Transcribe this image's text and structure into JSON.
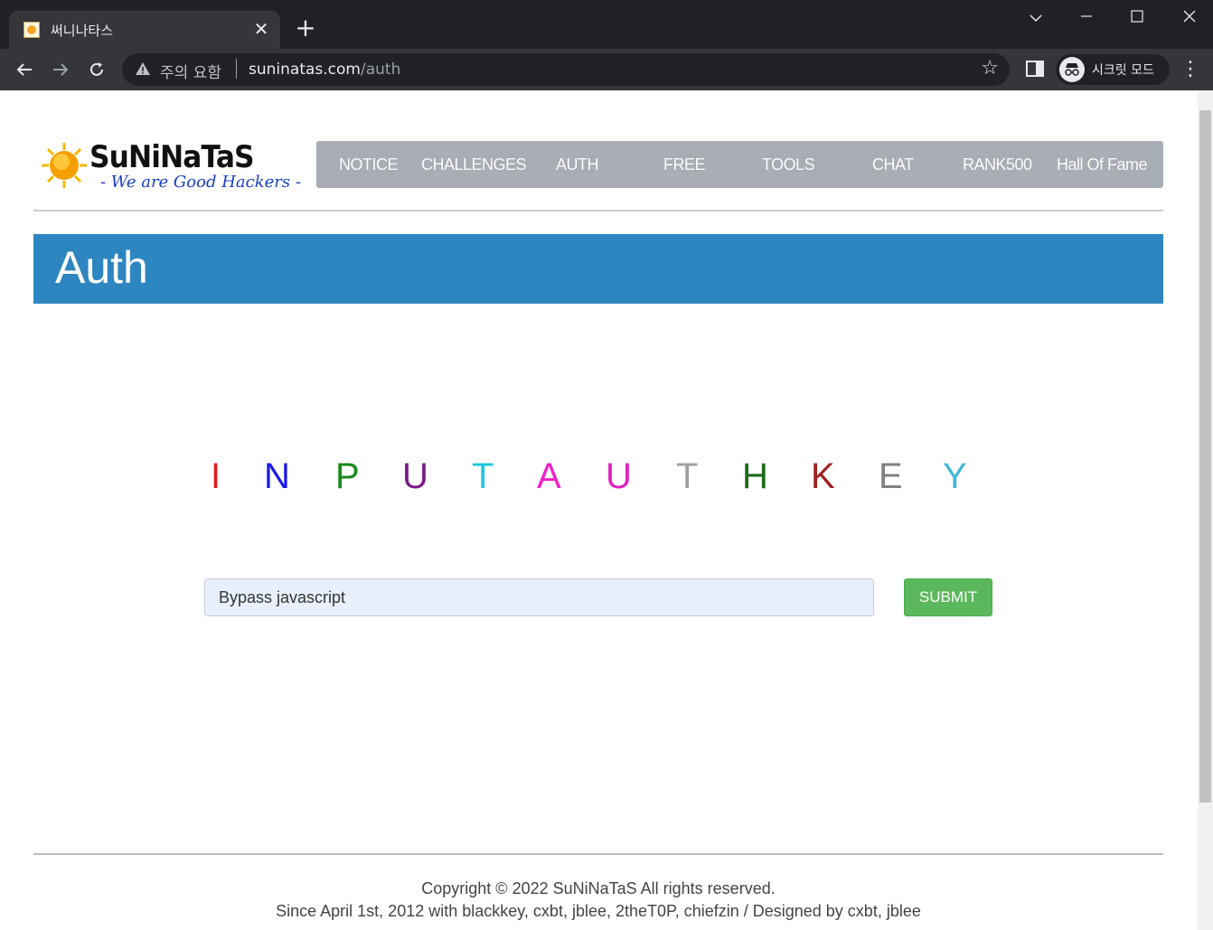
{
  "browser": {
    "tab_title": "써니나타스",
    "tab_close": "✕",
    "new_tab": "+",
    "security_warning": "주의 요함",
    "url_host": "suninatas.com",
    "url_path": "/auth",
    "incognito_label": "시크릿 모드"
  },
  "site": {
    "logo_title": "SuNiNaTaS",
    "logo_tagline": "- We are Good Hackers -",
    "nav": [
      "NOTICE",
      "CHALLENGES",
      "AUTH",
      "FREE",
      "TOOLS",
      "CHAT",
      "RANK500",
      "Hall Of Fame"
    ]
  },
  "page": {
    "title": "Auth",
    "auth_letters": [
      {
        "char": "I",
        "color": "#e02020"
      },
      {
        "char": "N",
        "color": "#1a1ae6"
      },
      {
        "char": "P",
        "color": "#1a8a1a"
      },
      {
        "char": "U",
        "color": "#7a1a8a"
      },
      {
        "char": "T",
        "color": "#20c8e0"
      },
      {
        "char": "A",
        "color": "#f020c8"
      },
      {
        "char": "U",
        "color": "#e020c0"
      },
      {
        "char": "T",
        "color": "#a0a0a0"
      },
      {
        "char": "H",
        "color": "#1a6a1a"
      },
      {
        "char": "K",
        "color": "#a02020"
      },
      {
        "char": "E",
        "color": "#808080"
      },
      {
        "char": "Y",
        "color": "#40b8d8"
      }
    ],
    "input_value": "Bypass javascript",
    "submit_label": "SUBMIT"
  },
  "footer": {
    "copyright": "Copyright © 2022 SuNiNaTaS All rights reserved.",
    "credits": "Since April 1st, 2012 with blackkey, cxbt, jblee, 2theT0P, chiefzin / Designed by cxbt, jblee"
  },
  "colors": {
    "banner": "#2e86c1",
    "nav_bg": "#a9adb4",
    "submit": "#5cb85c"
  }
}
